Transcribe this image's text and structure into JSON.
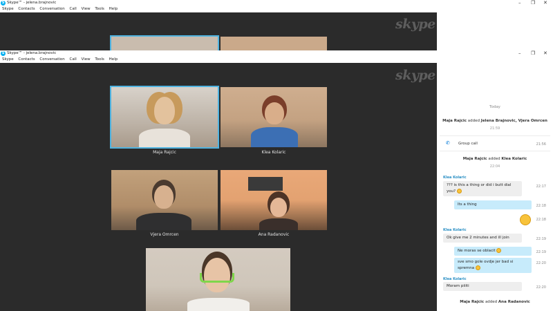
{
  "window_back": {
    "title": "Skype™ - jelena.brajnovic",
    "menu": [
      "Skype",
      "Contacts",
      "Conversation",
      "Call",
      "View",
      "Tools",
      "Help"
    ],
    "controls": [
      "–",
      "❐",
      "✕"
    ]
  },
  "window_front": {
    "title": "Skype™ - jelena.brajnovic",
    "menu": [
      "Skype",
      "Contacts",
      "Conversation",
      "Call",
      "View",
      "Tools",
      "Help"
    ],
    "controls": [
      "–",
      "❐",
      "✕"
    ]
  },
  "watermark": "skype",
  "participants": [
    {
      "name": "Maja Rajcic",
      "active": true
    },
    {
      "name": "Klea Kolaric",
      "active": false
    },
    {
      "name": "Vjera Omrcen",
      "active": false
    },
    {
      "name": "Ana Radanovic",
      "active": false
    }
  ],
  "chat": {
    "today": "Today",
    "events": [
      {
        "type": "system",
        "actor": "Maja Rajcic",
        "verb": "added",
        "target": "Jelena Brajnovic, Vjera Omrcen",
        "time": "21:59"
      },
      {
        "type": "call",
        "text": "Group call",
        "time": "21:56"
      },
      {
        "type": "system",
        "actor": "Maja Rajcic",
        "verb": "added",
        "target": "Klea Kolaric",
        "time": "22:04"
      }
    ],
    "sender_klea": "Klea Kolaric",
    "messages": [
      {
        "text": "??? is this a thing or did i butt dial you?",
        "time": "22:17",
        "dir": "in"
      },
      {
        "text": "Its a thing",
        "time": "22:18",
        "dir": "out"
      },
      {
        "text": "",
        "time": "22:18",
        "dir": "out-emoji"
      },
      {
        "text": "Ok give me 2 minutes and ill join",
        "time": "22:19",
        "dir": "in"
      },
      {
        "text": "Ne moras se oblacit",
        "time": "22:19",
        "dir": "out"
      },
      {
        "text": "sve smo gole ovdje   jer bad si spremna",
        "time": "22:20",
        "dir": "out"
      },
      {
        "text": "Moram piiiti",
        "time": "22:20",
        "dir": "in"
      }
    ],
    "last_system": {
      "actor": "Maja Rajcic",
      "verb": "added",
      "target": "Ana Radanovic"
    }
  },
  "colors": {
    "stage": "#2b2b2b",
    "active_outline": "#4fb3e0",
    "out_bubble": "#c7ebfb",
    "in_bubble": "#eeeeee",
    "sender": "#2a8fc4"
  }
}
